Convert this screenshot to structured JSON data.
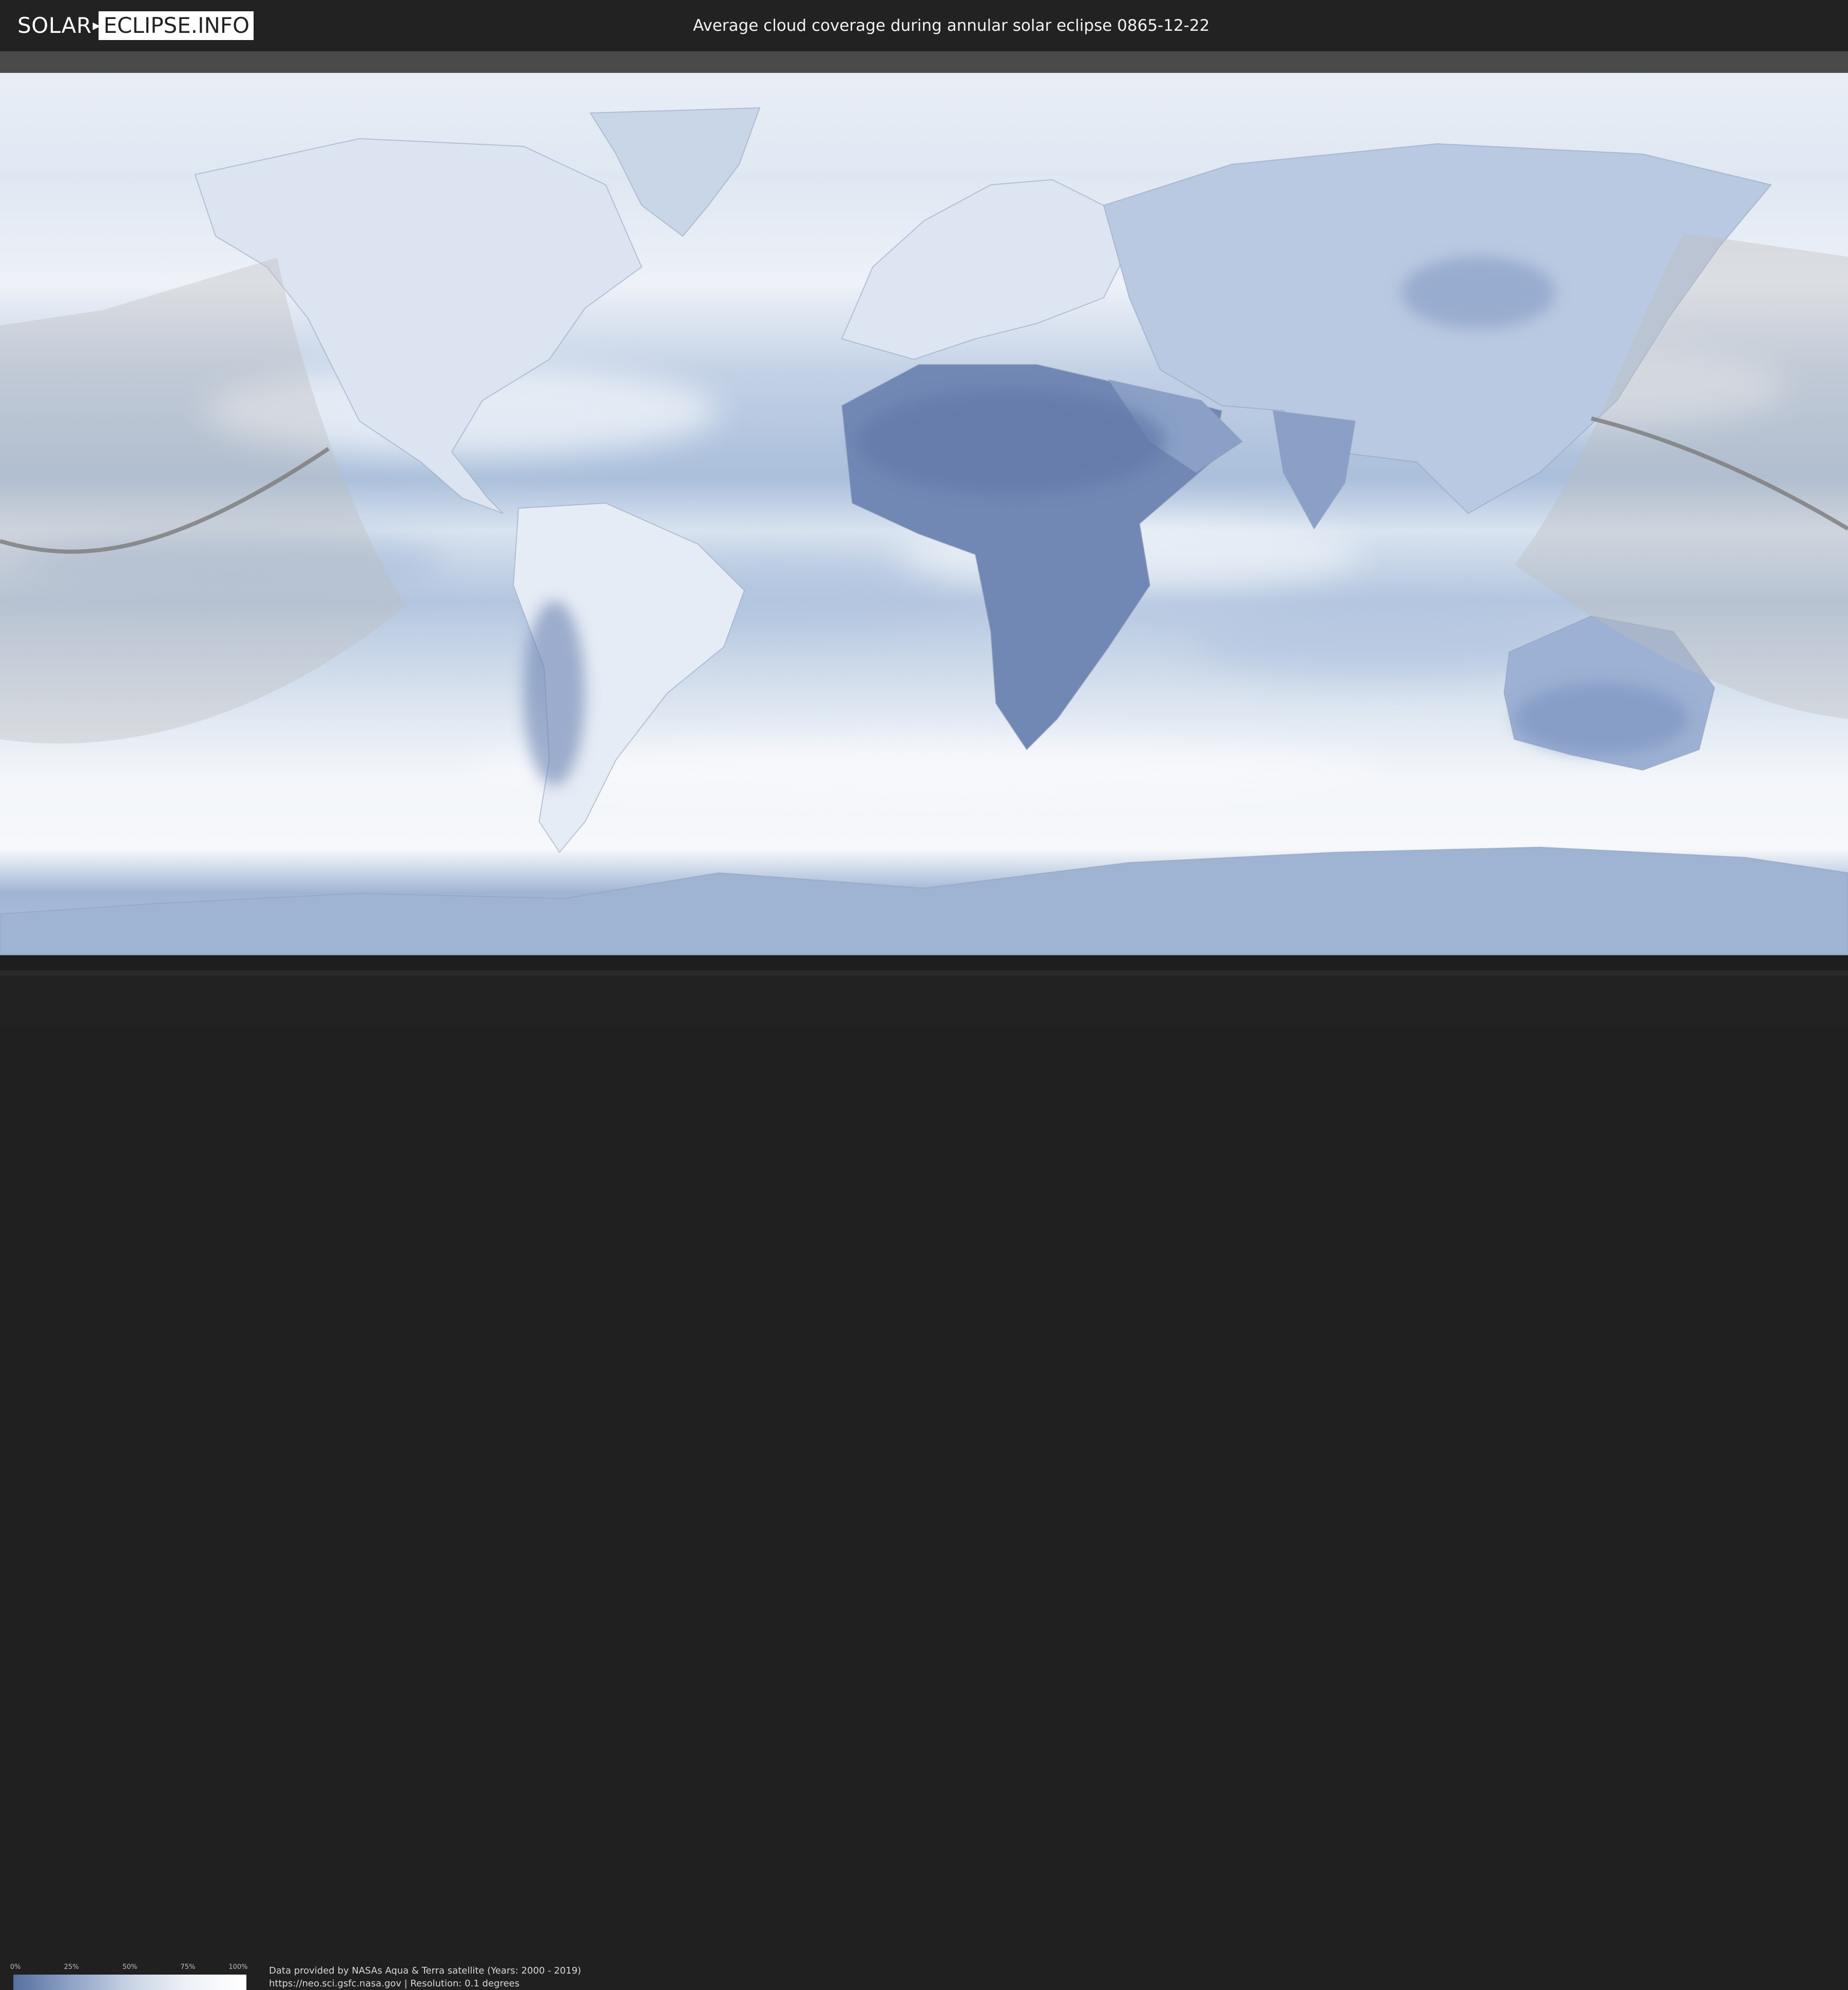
{
  "header": {
    "logo_left": "SOLAR",
    "logo_right": "ECLIPSE.INFO",
    "title": "Average cloud coverage during annular solar eclipse 0865-12-22"
  },
  "map": {
    "layer": "average cloud coverage",
    "colors": {
      "ocean_clear": "#a8bcd9",
      "cloudy": "#f4f7fb",
      "land_clear": "#6f86b3",
      "eclipse_zone": "#bdbdbd",
      "central_line": "#7a7a7a",
      "background": "#222222"
    }
  },
  "legend": {
    "ticks": [
      "0%",
      "25%",
      "50%",
      "75%",
      "100%"
    ]
  },
  "credits": {
    "line1": "Data provided by NASAs Aqua & Terra satellite (Years: 2000 - 2019)",
    "line2": "https://neo.sci.gsfc.nasa.gov | Resolution: 0.1 degrees"
  }
}
